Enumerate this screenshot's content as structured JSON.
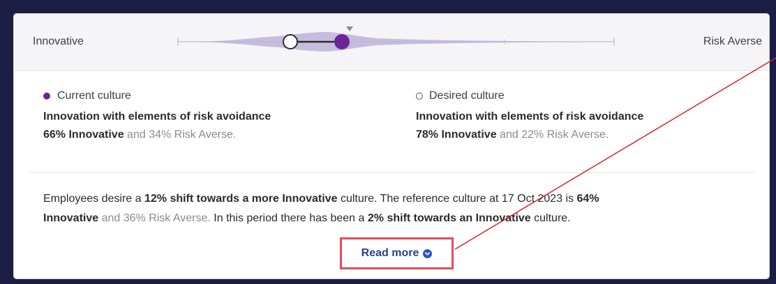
{
  "scale": {
    "left_label": "Innovative",
    "right_label": "Risk Averse",
    "current_innovative_pct": 66,
    "desired_innovative_pct": 78
  },
  "current": {
    "legend": "Current culture",
    "name": "Innovation with elements of risk avoidance",
    "pct_bold": "66% Innovative",
    "pct_rest": " and 34% Risk Averse."
  },
  "desired": {
    "legend": "Desired culture",
    "name": "Innovation with elements of risk avoidance",
    "pct_bold": "78% Innovative",
    "pct_rest": " and 22% Risk Averse."
  },
  "summary": {
    "p1": "Employees desire a ",
    "b1": "12% shift towards a more Innovative",
    "p2": " culture. The reference culture at 17 Oct 2023 is ",
    "b2": "64%",
    "b3": "Innovative",
    "p3": " and 36% Risk Averse.",
    "p4": " In this period there has been a ",
    "b4": "2% shift towards an Innovative",
    "p5": " culture."
  },
  "read_more": "Read more",
  "colors": {
    "current_dot": "#6b2594",
    "highlight_box": "#e84b57",
    "annotation_line": "#e0202a",
    "link": "#2c3f8f"
  }
}
